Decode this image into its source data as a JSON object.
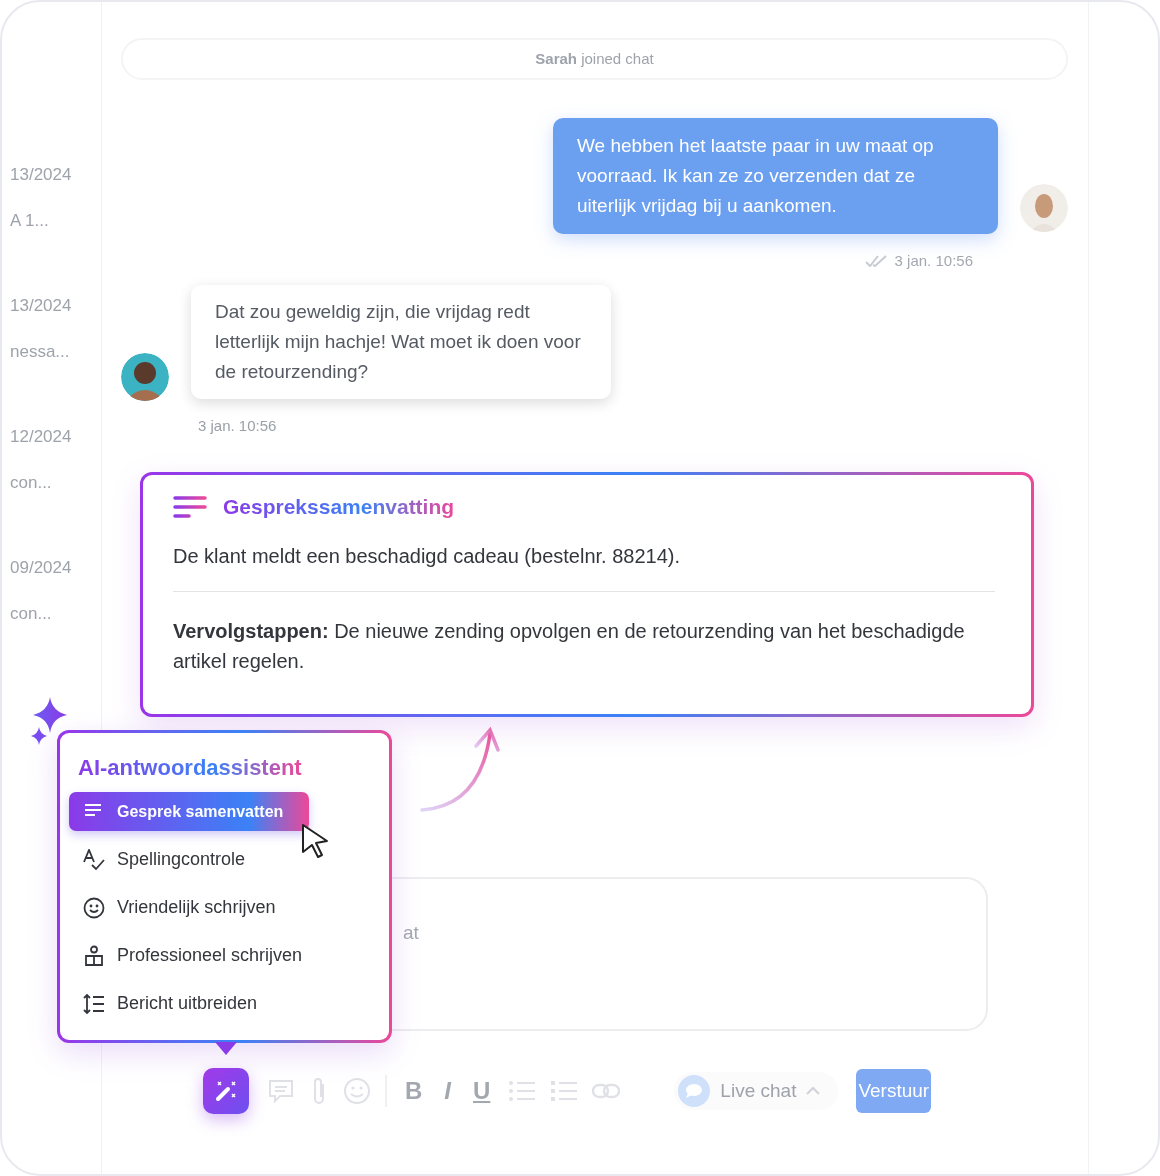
{
  "sidebar": {
    "items": [
      {
        "date": "13/2024",
        "preview": "A 1..."
      },
      {
        "date": "13/2024",
        "preview": "nessa..."
      },
      {
        "date": "12/2024",
        "preview": "con..."
      },
      {
        "date": "09/2024",
        "preview": "con..."
      }
    ]
  },
  "system_message": {
    "text": "**Sarah** joined chat"
  },
  "messages": [
    {
      "kind": "outgoing",
      "text": "We hebben het laatste paar in uw maat op voorraad. Ik kan ze zo verzenden dat ze uiterlijk vrijdag bij u aankomen.",
      "time": "3 jan. 10:56",
      "read": true
    },
    {
      "kind": "incoming",
      "text": "Dat zou geweldig zijn, die vrijdag redt letterlijk mijn hachje! Wat moet ik doen voor de retourzending?",
      "time": "3 jan. 10:56",
      "read": false
    }
  ],
  "summary": {
    "title": "Gesprekssamenvatting",
    "text": "De klant meldt een beschadigd cadeau (bestelnr. 88214).",
    "next_steps": "**Vervolgstappen:** De nieuwe zending opvolgen en de retourzending van het beschadigde artikel regelen."
  },
  "assistant": {
    "title": "AI-antwoordassistent",
    "items": [
      {
        "label": "Gesprek samenvatten",
        "kind": "summary",
        "selected": true
      },
      {
        "label": "Spellingcontrole",
        "kind": "spelling",
        "selected": false
      },
      {
        "label": "Vriendelijk schrijven",
        "kind": "smile",
        "selected": false
      },
      {
        "label": "Professioneel schrijven",
        "kind": "person",
        "selected": false
      },
      {
        "label": "Bericht uitbreiden",
        "kind": "expand",
        "selected": false
      }
    ]
  },
  "composer": {
    "placeholder": "at",
    "format_buttons": [
      "B",
      "I",
      "U"
    ],
    "channel": "Live chat",
    "send": "Verstuur"
  }
}
